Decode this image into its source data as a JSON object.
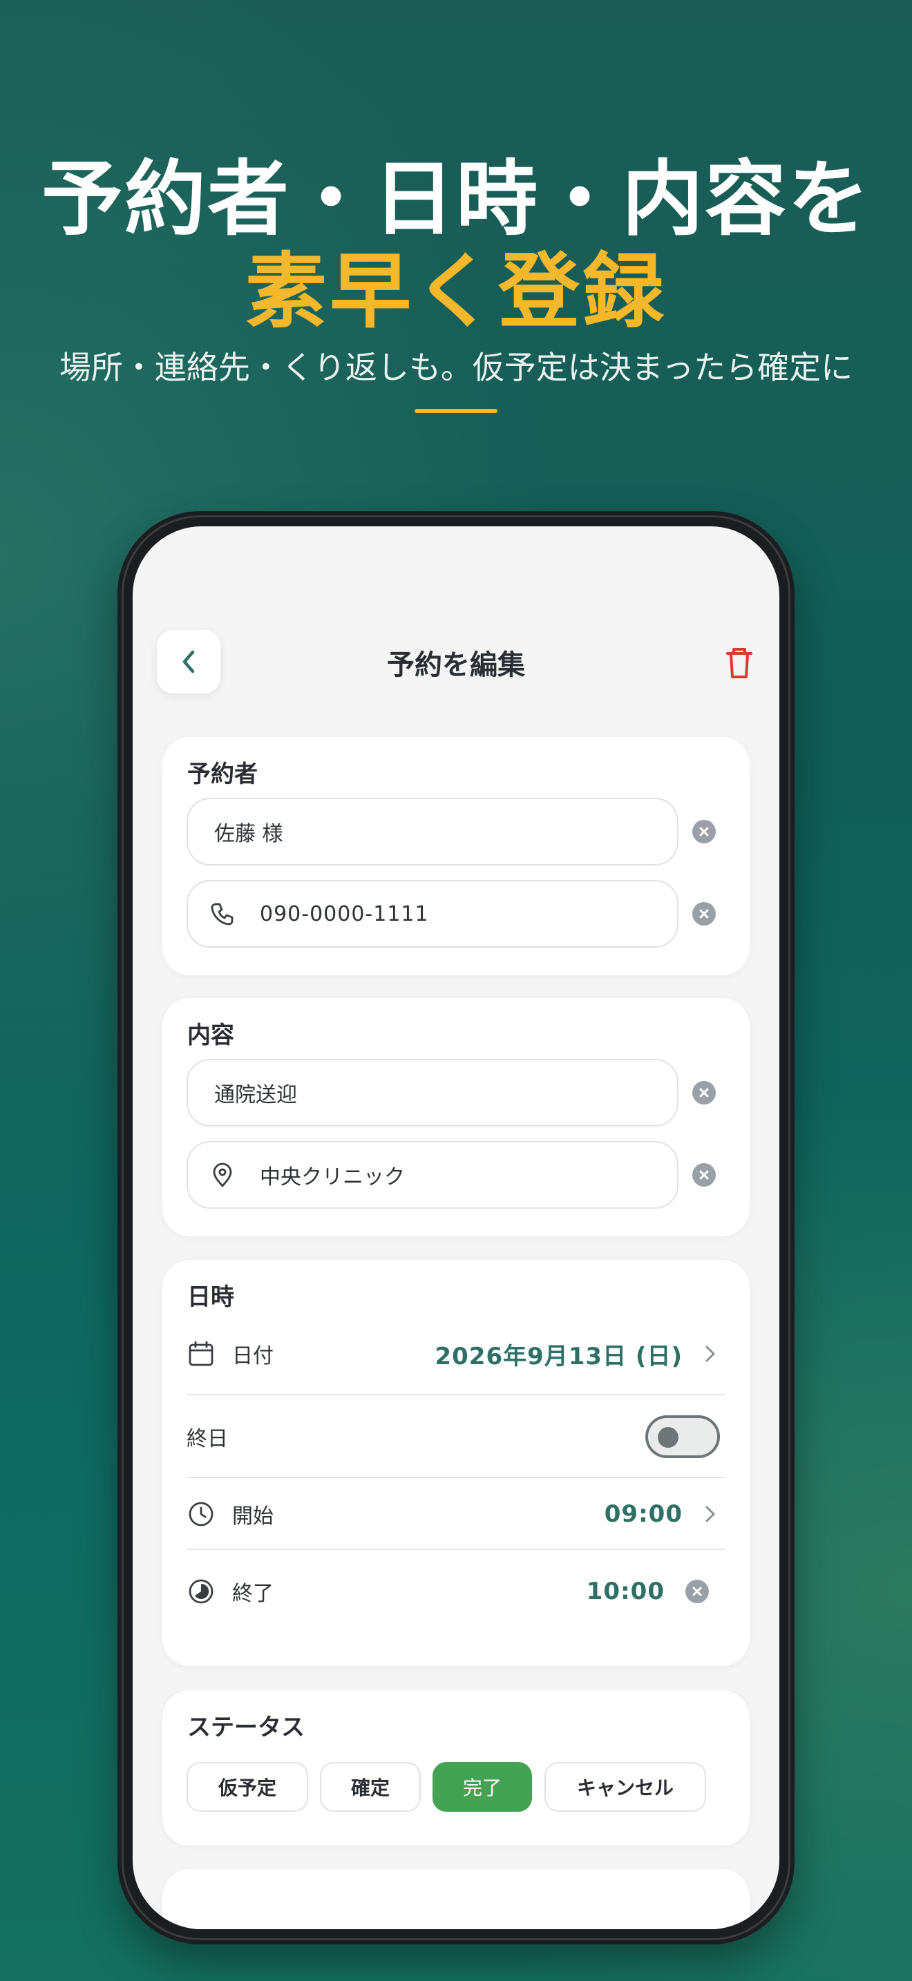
{
  "hero": {
    "line1": "予約者・日時・内容を",
    "line2": "素早く登録",
    "subtitle": "場所・連絡先・くり返しも。仮予定は決まったら確定に"
  },
  "nav": {
    "title": "予約を編集",
    "back_icon": "chevron-left-icon",
    "delete_icon": "trash-icon"
  },
  "reserver": {
    "title": "予約者",
    "name_value": "佐藤 様",
    "phone_value": "090-0000-1111"
  },
  "content": {
    "title": "内容",
    "description_value": "通院送迎",
    "location_value": "中央クリニック"
  },
  "datetime": {
    "title": "日時",
    "date_label": "日付",
    "date_value": "2026年9月13日 (日)",
    "allday_label": "終日",
    "allday_on": false,
    "start_label": "開始",
    "start_value": "09:00",
    "end_label": "終了",
    "end_value": "10:00"
  },
  "status": {
    "title": "ステータス",
    "options": [
      "仮予定",
      "確定",
      "完了",
      "キャンセル"
    ],
    "selected": "完了"
  },
  "colors": {
    "accent": "#f6b82b",
    "value_teal": "#2e6f66",
    "status_active": "#43a352",
    "delete_red": "#d93a30"
  }
}
